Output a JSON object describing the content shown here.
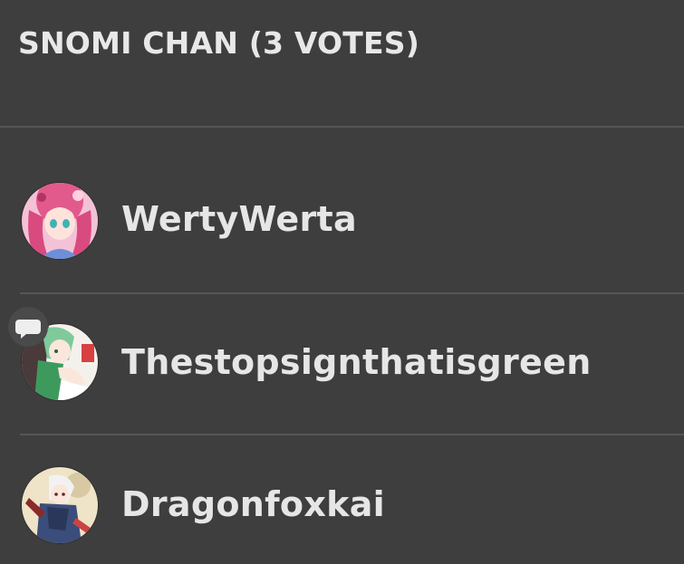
{
  "poll": {
    "title": "SNOMI CHAN (3 VOTES)"
  },
  "voters": [
    {
      "username": "WertyWerta",
      "avatar_icon": "anime-girl-pink-hair-avatar"
    },
    {
      "username": "Thestopsignthatisgreen",
      "avatar_icon": "anime-girl-green-hair-avatar",
      "badge_icon": "chat-bubble-icon"
    },
    {
      "username": "Dragonfoxkai",
      "avatar_icon": "anime-character-white-hair-avatar"
    }
  ],
  "colors": {
    "background": "#3e3e3e",
    "divider": "#555555",
    "text": "#e6e6e6"
  }
}
